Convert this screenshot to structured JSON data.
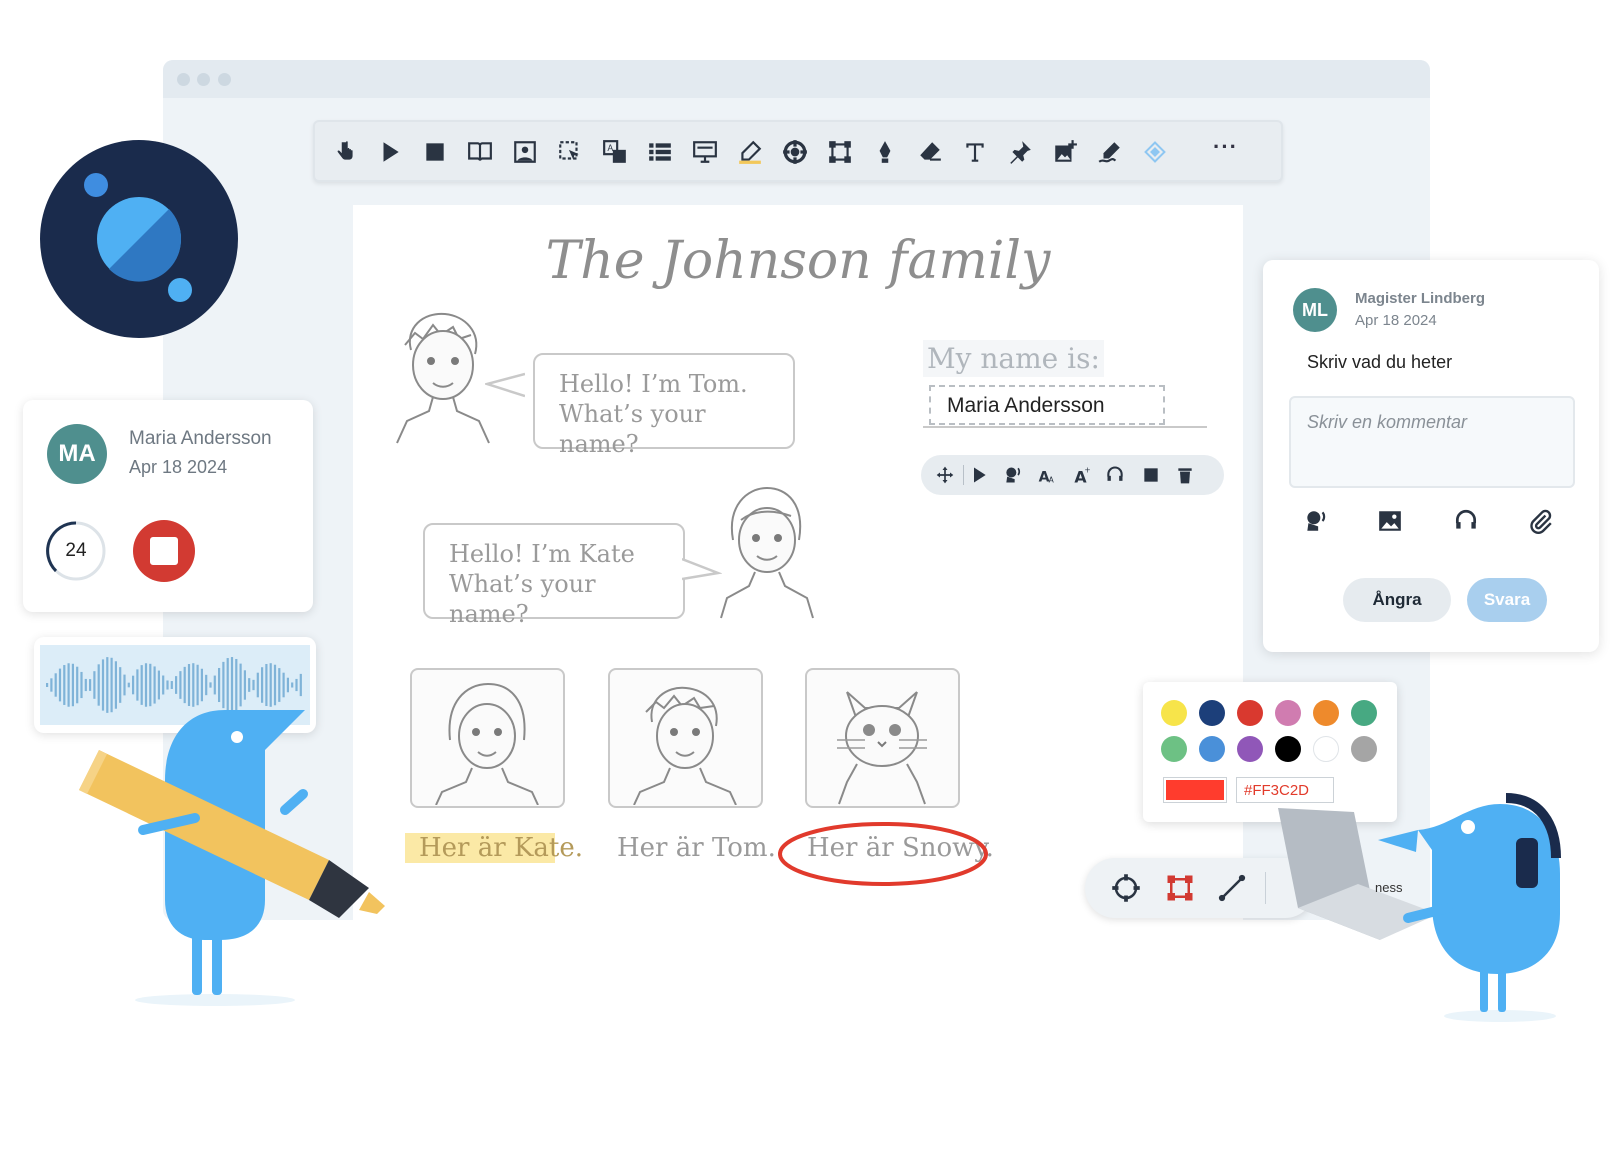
{
  "worksheet": {
    "title": "The Johnson family",
    "bubble_tom_line1": "Hello! I’m Tom.",
    "bubble_tom_line2": "What’s your name?",
    "bubble_kate_line1": "Hello! I’m Kate",
    "bubble_kate_line2": "What’s your name?",
    "my_name_label": "My name is:",
    "name_value": "Maria Andersson",
    "captions": [
      "Her är Kate.",
      "Her är Tom.",
      "Her är Snowy."
    ]
  },
  "toolbar": {
    "icons": [
      "touch-icon",
      "play-icon",
      "stop-icon",
      "book-icon",
      "image-icon",
      "select-icon",
      "translate-icon",
      "list-icon",
      "presentation-icon",
      "highlighter-icon",
      "lifebuoy-icon",
      "transform-icon",
      "pen-nib-icon",
      "eraser-icon",
      "text-icon",
      "pin-icon",
      "add-image-icon",
      "signature-icon",
      "diamond-icon"
    ],
    "more_label": "···"
  },
  "student_card": {
    "initials": "MA",
    "name": "Maria Andersson",
    "date": "Apr 18 2024",
    "counter": "24"
  },
  "comment_panel": {
    "initials": "ML",
    "author": "Magister Lindberg",
    "date": "Apr 18 2024",
    "message": "Skriv vad du heter",
    "placeholder": "Skriv en kommentar",
    "undo_label": "Ångra",
    "reply_label": "Svara"
  },
  "color_picker": {
    "swatches": [
      "#f7e44a",
      "#1c3f7a",
      "#d9392f",
      "#d07cb0",
      "#ee8a2c",
      "#47a982",
      "#6dc184",
      "#4a90d9",
      "#9057b8",
      "#000000",
      "#ffffff",
      "#a5a5a5"
    ],
    "current_color": "#FF3C2D",
    "hex_label": "#FF3C2D"
  },
  "laptop_text": "ness",
  "colors": {
    "highlight": "#fbe9a6",
    "circle_annotation": "#e13a2c",
    "accent_blue": "#4fb0f3",
    "logo_bg": "#1a2b4c",
    "stop_red": "#d23a32"
  }
}
